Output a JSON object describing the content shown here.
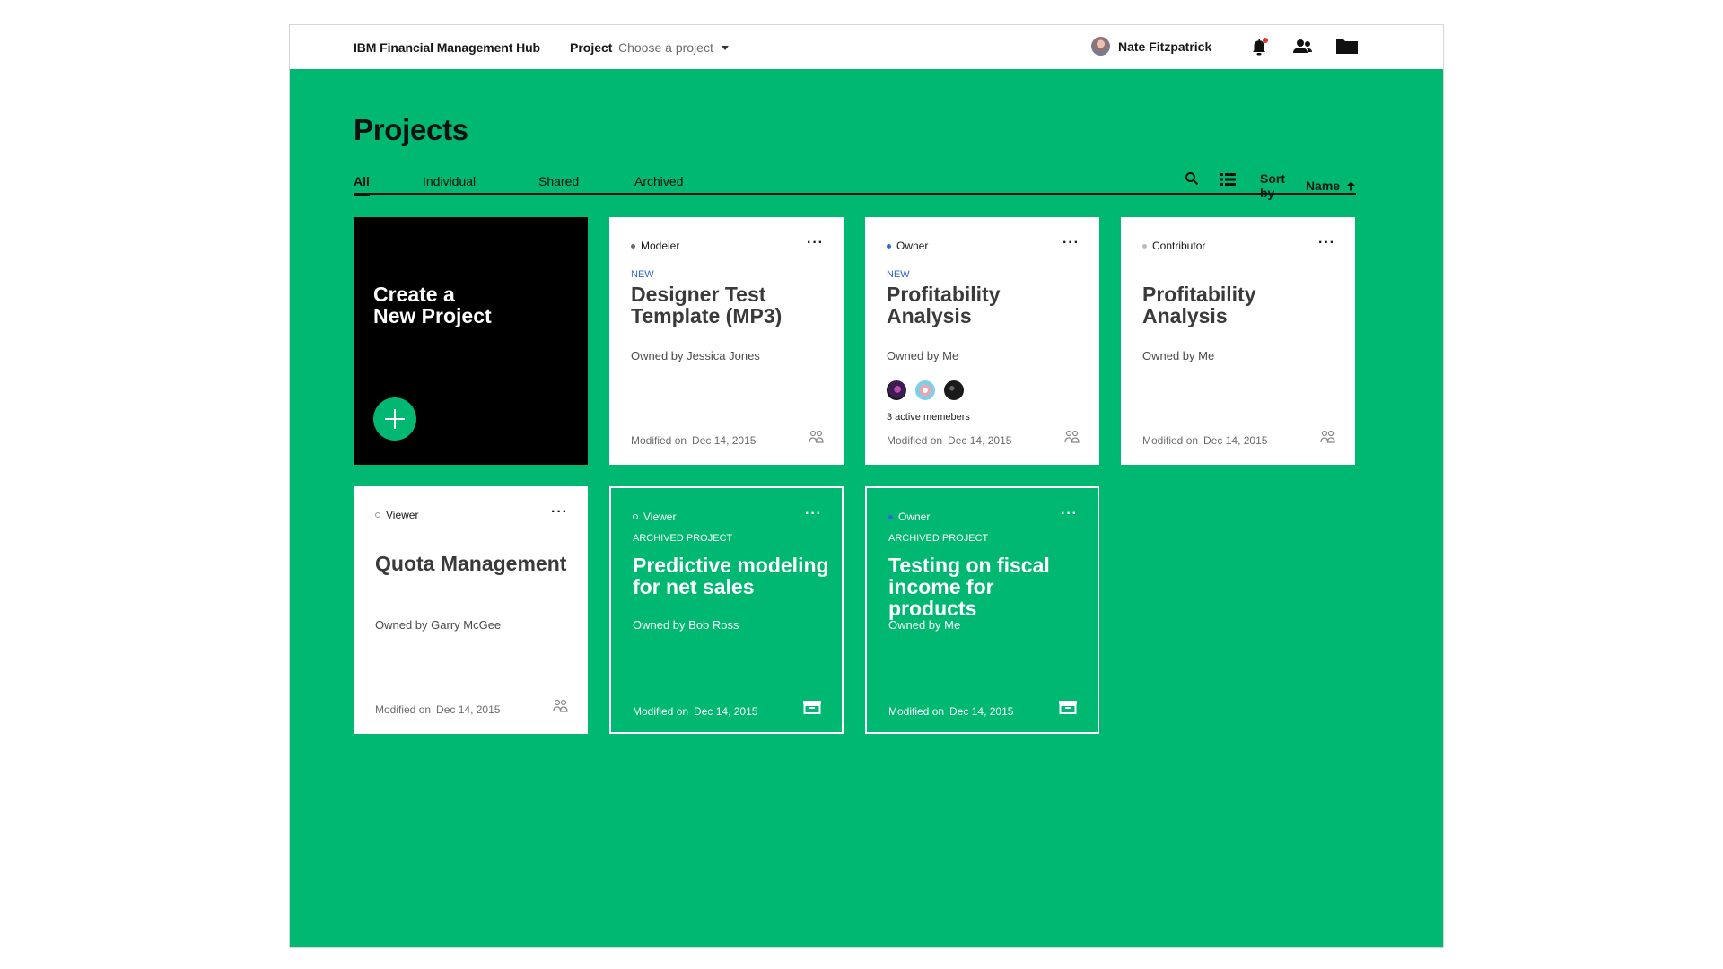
{
  "topbar": {
    "app_title": "IBM Financial Management Hub",
    "project_label": "Project",
    "project_placeholder": "Choose a project",
    "user_name": "Nate Fitzpatrick",
    "icons": [
      "bell-icon",
      "people-icon",
      "folder-icon"
    ],
    "notification_dot_color": "#e5302b"
  },
  "page": {
    "title": "Projects",
    "tabs": [
      {
        "label": "All",
        "active": true
      },
      {
        "label": "Individual",
        "active": false
      },
      {
        "label": "Shared",
        "active": false
      },
      {
        "label": "Archived",
        "active": false
      }
    ],
    "sort_label": "Sort by",
    "sort_value": "Name",
    "sort_direction": "ascending"
  },
  "create_card": {
    "title_line1": "Create a",
    "title_line2": "New Project"
  },
  "cards": [
    {
      "role": "Modeler",
      "badge": "NEW",
      "title": "Designer Test Template (MP3)",
      "owner": "Owned by Jessica Jones",
      "members_label": "",
      "modified_label": "Modified on",
      "modified_date": "Dec 14, 2015",
      "archived": false
    },
    {
      "role": "Owner",
      "badge": "NEW",
      "title": "Profitability Analysis",
      "owner": "Owned by Me",
      "members_label": "3 active memebers",
      "modified_label": "Modified on",
      "modified_date": "Dec 14, 2015",
      "archived": false
    },
    {
      "role": "Contributor",
      "badge": "",
      "title": "Profitability Analysis",
      "owner": "Owned by Me",
      "members_label": "",
      "modified_label": "Modified on",
      "modified_date": "Dec 14, 2015",
      "archived": false
    },
    {
      "role": "Viewer",
      "badge": "",
      "title": "Quota Management",
      "owner": "Owned by Garry McGee",
      "members_label": "",
      "modified_label": "Modified on",
      "modified_date": "Dec 14, 2015",
      "archived": false
    },
    {
      "role": "Viewer",
      "badge": "ARCHIVED PROJECT",
      "title": "Predictive modeling for net sales",
      "owner": "Owned by Bob Ross",
      "members_label": "",
      "modified_label": "Modified on",
      "modified_date": "Dec 14, 2015",
      "archived": true
    },
    {
      "role": "Owner",
      "badge": "ARCHIVED PROJECT",
      "title": "Testing on fiscal income for products",
      "owner": "Owned by Me",
      "members_label": "",
      "modified_label": "Modified on",
      "modified_date": "Dec 14, 2015",
      "archived": true
    }
  ],
  "colors": {
    "brand_green": "#00b871",
    "accent_blue": "#3366dd",
    "text_dark": "#171717"
  }
}
